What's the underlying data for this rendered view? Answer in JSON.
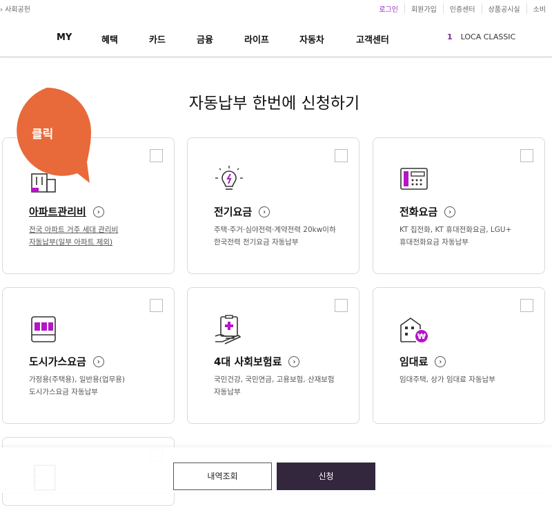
{
  "topbar": {
    "left_text": "› 사회공헌",
    "links": [
      "로그인",
      "회원가입",
      "인증센터",
      "상품공시실",
      "소비"
    ]
  },
  "gnb": {
    "menus": [
      "MY",
      "혜택",
      "카드",
      "금융",
      "라이프",
      "자동차",
      "고객센터"
    ],
    "card_number": "1",
    "card_name": "LOCA CLASSIC"
  },
  "page_title": "자동납부 한번에 신청하기",
  "bubble_label": "클릭",
  "arrow_glyph": "›",
  "cards": [
    {
      "title": "아파트관리비",
      "desc": [
        "전국 아파트 거주 세대 관리비",
        "자동납부(일부 아파트 제외)"
      ],
      "icon": "apartment-icon"
    },
    {
      "title": "전기요금",
      "desc": [
        "주택·주거·심야전력·계약전력 20kw이하",
        "한국전력 전기요금 자동납부"
      ],
      "icon": "lightbulb-icon"
    },
    {
      "title": "전화요금",
      "desc": [
        "KT 집전화, KT 휴대전화요금, LGU+",
        "휴대전화요금 자동납부"
      ],
      "icon": "telephone-icon"
    },
    {
      "title": "도시가스요금",
      "desc": [
        "가정용(주택용), 일반용(업무용)",
        "도시가스요금 자동납부"
      ],
      "icon": "gas-meter-icon"
    },
    {
      "title": "4대 사회보험료",
      "desc": [
        "국민건강, 국민연금, 고용보험, 산재보험",
        "자동납부"
      ],
      "icon": "insurance-clipboard-icon"
    },
    {
      "title": "임대료",
      "desc": [
        "임대주택, 상가 임대료 자동납부"
      ],
      "icon": "rent-building-icon"
    }
  ],
  "footer": {
    "history_label": "내역조회",
    "apply_label": "신청"
  },
  "colors": {
    "accent": "#9b2cc1",
    "bubble": "#e8693a",
    "dark_button": "#33273d"
  }
}
